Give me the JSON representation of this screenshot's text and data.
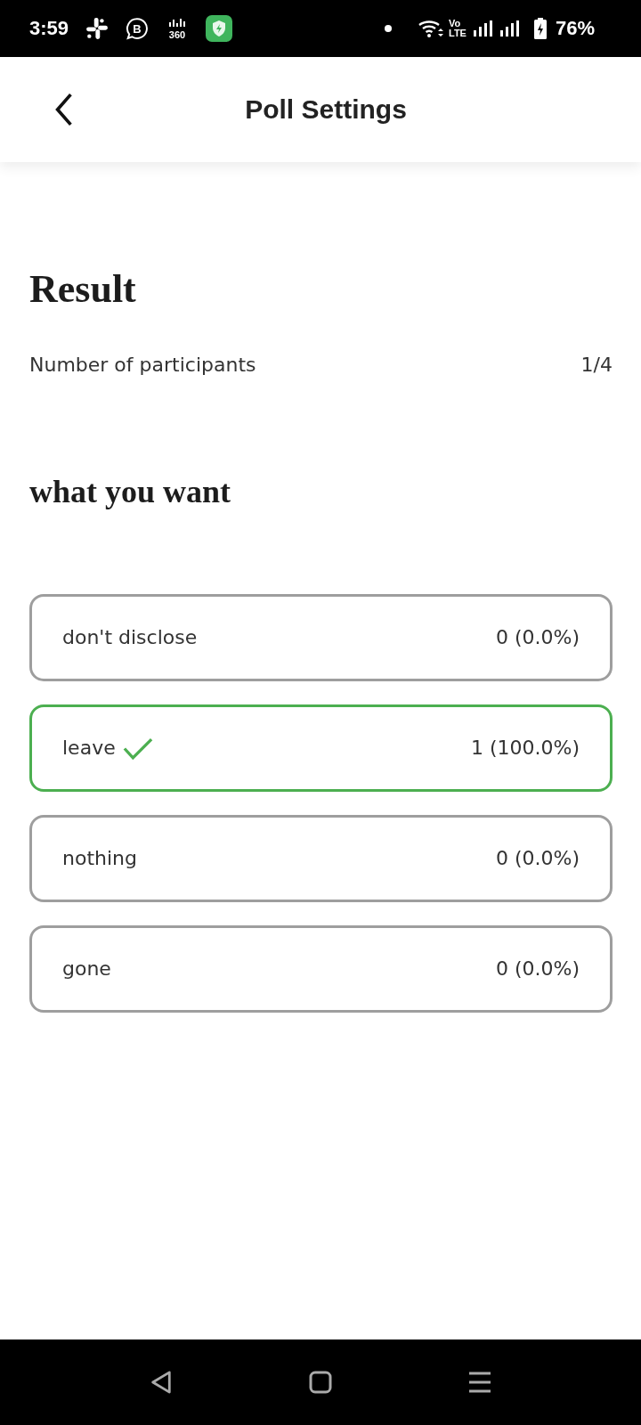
{
  "status_bar": {
    "time": "3:59",
    "chat_badge": "B",
    "app_badge": "360",
    "volte": [
      "Vo",
      "LTE"
    ],
    "battery": "76%"
  },
  "app_bar": {
    "title": "Poll Settings"
  },
  "result": {
    "heading": "Result",
    "participants_label": "Number of participants",
    "participants_count": "1/4"
  },
  "poll": {
    "question": "what you want",
    "options": [
      {
        "label": "don't disclose",
        "result": "0 (0.0%)",
        "selected": false
      },
      {
        "label": "leave",
        "result": "1 (100.0%)",
        "selected": true
      },
      {
        "label": "nothing",
        "result": "0 (0.0%)",
        "selected": false
      },
      {
        "label": "gone",
        "result": "0 (0.0%)",
        "selected": false
      }
    ]
  }
}
